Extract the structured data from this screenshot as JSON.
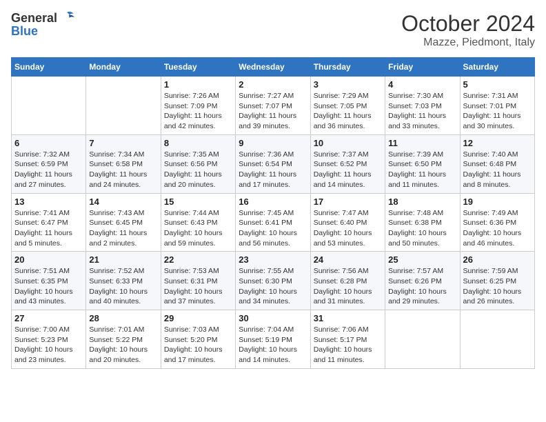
{
  "header": {
    "logo_general": "General",
    "logo_blue": "Blue",
    "month_title": "October 2024",
    "location": "Mazze, Piedmont, Italy"
  },
  "weekdays": [
    "Sunday",
    "Monday",
    "Tuesday",
    "Wednesday",
    "Thursday",
    "Friday",
    "Saturday"
  ],
  "weeks": [
    [
      {
        "day": "",
        "info": ""
      },
      {
        "day": "",
        "info": ""
      },
      {
        "day": "1",
        "info": "Sunrise: 7:26 AM\nSunset: 7:09 PM\nDaylight: 11 hours and 42 minutes."
      },
      {
        "day": "2",
        "info": "Sunrise: 7:27 AM\nSunset: 7:07 PM\nDaylight: 11 hours and 39 minutes."
      },
      {
        "day": "3",
        "info": "Sunrise: 7:29 AM\nSunset: 7:05 PM\nDaylight: 11 hours and 36 minutes."
      },
      {
        "day": "4",
        "info": "Sunrise: 7:30 AM\nSunset: 7:03 PM\nDaylight: 11 hours and 33 minutes."
      },
      {
        "day": "5",
        "info": "Sunrise: 7:31 AM\nSunset: 7:01 PM\nDaylight: 11 hours and 30 minutes."
      }
    ],
    [
      {
        "day": "6",
        "info": "Sunrise: 7:32 AM\nSunset: 6:59 PM\nDaylight: 11 hours and 27 minutes."
      },
      {
        "day": "7",
        "info": "Sunrise: 7:34 AM\nSunset: 6:58 PM\nDaylight: 11 hours and 24 minutes."
      },
      {
        "day": "8",
        "info": "Sunrise: 7:35 AM\nSunset: 6:56 PM\nDaylight: 11 hours and 20 minutes."
      },
      {
        "day": "9",
        "info": "Sunrise: 7:36 AM\nSunset: 6:54 PM\nDaylight: 11 hours and 17 minutes."
      },
      {
        "day": "10",
        "info": "Sunrise: 7:37 AM\nSunset: 6:52 PM\nDaylight: 11 hours and 14 minutes."
      },
      {
        "day": "11",
        "info": "Sunrise: 7:39 AM\nSunset: 6:50 PM\nDaylight: 11 hours and 11 minutes."
      },
      {
        "day": "12",
        "info": "Sunrise: 7:40 AM\nSunset: 6:48 PM\nDaylight: 11 hours and 8 minutes."
      }
    ],
    [
      {
        "day": "13",
        "info": "Sunrise: 7:41 AM\nSunset: 6:47 PM\nDaylight: 11 hours and 5 minutes."
      },
      {
        "day": "14",
        "info": "Sunrise: 7:43 AM\nSunset: 6:45 PM\nDaylight: 11 hours and 2 minutes."
      },
      {
        "day": "15",
        "info": "Sunrise: 7:44 AM\nSunset: 6:43 PM\nDaylight: 10 hours and 59 minutes."
      },
      {
        "day": "16",
        "info": "Sunrise: 7:45 AM\nSunset: 6:41 PM\nDaylight: 10 hours and 56 minutes."
      },
      {
        "day": "17",
        "info": "Sunrise: 7:47 AM\nSunset: 6:40 PM\nDaylight: 10 hours and 53 minutes."
      },
      {
        "day": "18",
        "info": "Sunrise: 7:48 AM\nSunset: 6:38 PM\nDaylight: 10 hours and 50 minutes."
      },
      {
        "day": "19",
        "info": "Sunrise: 7:49 AM\nSunset: 6:36 PM\nDaylight: 10 hours and 46 minutes."
      }
    ],
    [
      {
        "day": "20",
        "info": "Sunrise: 7:51 AM\nSunset: 6:35 PM\nDaylight: 10 hours and 43 minutes."
      },
      {
        "day": "21",
        "info": "Sunrise: 7:52 AM\nSunset: 6:33 PM\nDaylight: 10 hours and 40 minutes."
      },
      {
        "day": "22",
        "info": "Sunrise: 7:53 AM\nSunset: 6:31 PM\nDaylight: 10 hours and 37 minutes."
      },
      {
        "day": "23",
        "info": "Sunrise: 7:55 AM\nSunset: 6:30 PM\nDaylight: 10 hours and 34 minutes."
      },
      {
        "day": "24",
        "info": "Sunrise: 7:56 AM\nSunset: 6:28 PM\nDaylight: 10 hours and 31 minutes."
      },
      {
        "day": "25",
        "info": "Sunrise: 7:57 AM\nSunset: 6:26 PM\nDaylight: 10 hours and 29 minutes."
      },
      {
        "day": "26",
        "info": "Sunrise: 7:59 AM\nSunset: 6:25 PM\nDaylight: 10 hours and 26 minutes."
      }
    ],
    [
      {
        "day": "27",
        "info": "Sunrise: 7:00 AM\nSunset: 5:23 PM\nDaylight: 10 hours and 23 minutes."
      },
      {
        "day": "28",
        "info": "Sunrise: 7:01 AM\nSunset: 5:22 PM\nDaylight: 10 hours and 20 minutes."
      },
      {
        "day": "29",
        "info": "Sunrise: 7:03 AM\nSunset: 5:20 PM\nDaylight: 10 hours and 17 minutes."
      },
      {
        "day": "30",
        "info": "Sunrise: 7:04 AM\nSunset: 5:19 PM\nDaylight: 10 hours and 14 minutes."
      },
      {
        "day": "31",
        "info": "Sunrise: 7:06 AM\nSunset: 5:17 PM\nDaylight: 10 hours and 11 minutes."
      },
      {
        "day": "",
        "info": ""
      },
      {
        "day": "",
        "info": ""
      }
    ]
  ]
}
